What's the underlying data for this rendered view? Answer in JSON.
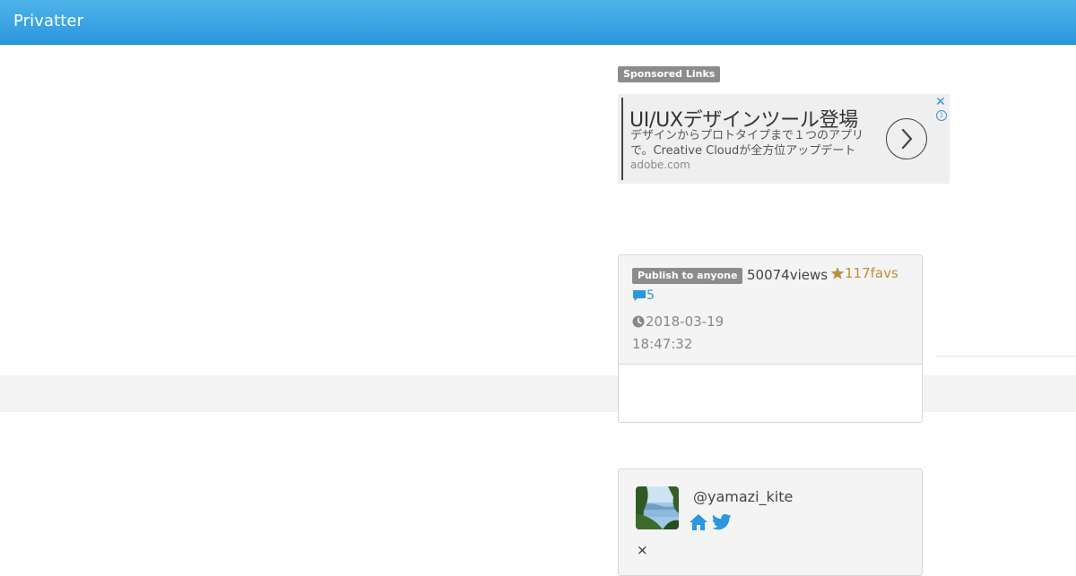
{
  "header": {
    "brand": "Privatter"
  },
  "sponsored": {
    "label": "Sponsored Links",
    "ad": {
      "headline": "UI/UXデザインツール登場",
      "description": "デザインからプロトタイプまで１つのアプリで。Creative Cloudが全方位アップデート",
      "domain": "adobe.com",
      "close_symbol": "✕",
      "info_symbol": "i"
    }
  },
  "post_info": {
    "visibility_badge": "Publish to anyone",
    "views": "50074views",
    "favs": "117favs",
    "comments": "5",
    "date": "2018-03-19",
    "time": "18:47:32"
  },
  "user": {
    "handle": "@yamazi_kite",
    "close_symbol": "×"
  },
  "colors": {
    "header_top": "#4fb3ea",
    "header_bottom": "#2b97de",
    "fav_gold": "#bf8d3c",
    "link_blue": "#2b97de",
    "badge_gray": "#8c8c8c"
  },
  "icons": [
    "arrow-right-icon",
    "close-icon",
    "info-icon",
    "star-icon",
    "comment-icon",
    "clock-icon",
    "home-icon",
    "twitter-icon"
  ]
}
